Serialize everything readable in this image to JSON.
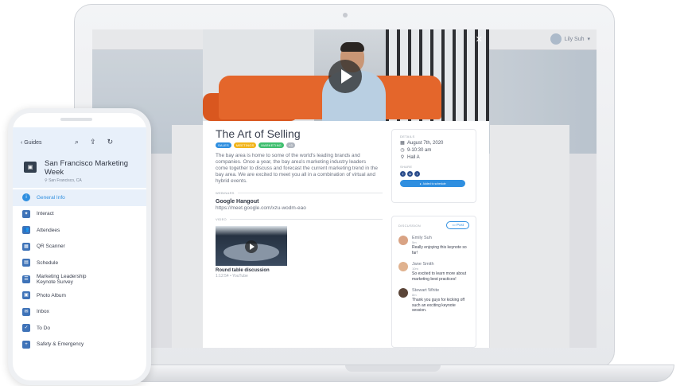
{
  "header": {
    "user_name": "Lily Suh"
  },
  "modal": {
    "title": "The Art of Selling",
    "tags": [
      {
        "label": "Sales",
        "color": "#2f8fe0"
      },
      {
        "label": "Meetings",
        "color": "#f2b51c"
      },
      {
        "label": "Marketing",
        "color": "#3fbf6f"
      },
      {
        "label": "+3",
        "color": "#b0b6bf"
      }
    ],
    "description": "The bay area is home to some of the world's leading brands and companies. Once a year, the bay area's marketing industry leaders come together to discuss and forecast the current marketing trend in the bay area. We are excited to meet you all in a combination of virtual and hybrid events.",
    "webinars_label": "Webinars",
    "hangout_title": "Google Hangout",
    "hangout_url": "https://meet.google.com/xzu-wodm-eao",
    "videos_label": "Video",
    "video_title": "Round table discussion",
    "video_meta": "1:12:54 • YouTube",
    "details_label": "Details",
    "date": "August 7th, 2020",
    "time": "9-10:30 am",
    "location": "Hall A",
    "share_label": "Share",
    "add_button": "Added to schedule",
    "discussion_label": "Discussion",
    "post_button": "Post",
    "comments": [
      {
        "name": "Emily Suh",
        "time": "5m",
        "text": "Really enjoying this keynote so far!",
        "avatar_color": "#d9a384"
      },
      {
        "name": "Jane Smith",
        "time": "10m",
        "text": "So excited to learn more about marketing best practices!",
        "avatar_color": "#e0b28f"
      },
      {
        "name": "Stewart White",
        "time": "8m",
        "text": "Thank you guys for kicking off such an exciting keynote session.",
        "avatar_color": "#5b4538"
      }
    ]
  },
  "phone": {
    "back_label": "Guides",
    "event_name": "San Francisco Marketing Week",
    "event_location": "San Francisco, CA",
    "menu": [
      {
        "label": "General Info",
        "icon": "i",
        "active": true
      },
      {
        "label": "Interact",
        "icon": "✦"
      },
      {
        "label": "Attendees",
        "icon": "👥"
      },
      {
        "label": "QR Scanner",
        "icon": "▦"
      },
      {
        "label": "Schedule",
        "icon": "▤"
      },
      {
        "label": "Marketing Leadership Keynote Survey",
        "icon": "☰"
      },
      {
        "label": "Photo Album",
        "icon": "▣"
      },
      {
        "label": "Inbox",
        "icon": "✉"
      },
      {
        "label": "To Do",
        "icon": "✓"
      },
      {
        "label": "Safety & Emergency",
        "icon": "+"
      }
    ]
  }
}
